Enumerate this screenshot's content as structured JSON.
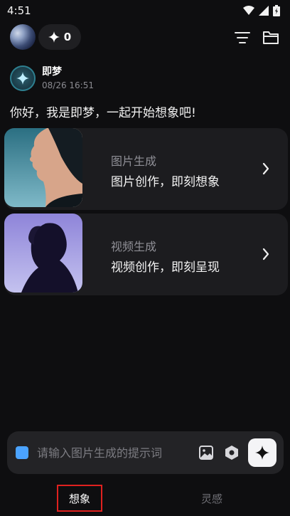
{
  "status_bar": {
    "time": "4:51"
  },
  "top_bar": {
    "credits": "0"
  },
  "bot": {
    "name": "即梦",
    "timestamp": "08/26 16:51",
    "greeting": "你好，我是即梦，一起开始想象吧!"
  },
  "cards": [
    {
      "kicker": "图片生成",
      "title": "图片创作，即刻想象"
    },
    {
      "kicker": "视频生成",
      "title": "视频创作，即刻呈现"
    }
  ],
  "input": {
    "placeholder": "请输入图片生成的提示词"
  },
  "tabs": [
    {
      "label": "想象",
      "active": true
    },
    {
      "label": "灵感",
      "active": false
    }
  ],
  "colors": {
    "accent_blue": "#4ba3ff",
    "active_tab_border": "#e0211f"
  },
  "icons": [
    "wifi-icon",
    "signal-icon",
    "battery-icon",
    "sparkle-icon",
    "filter-icon",
    "folder-icon",
    "chevron-right-icon",
    "image-icon",
    "hexagon-settings-icon"
  ]
}
